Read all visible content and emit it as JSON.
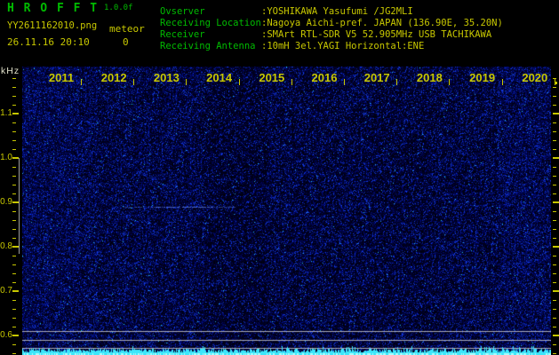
{
  "header": {
    "app_title": "H R O F F T",
    "version": "1.0.0f",
    "filename": "YY2611162010.png",
    "mode_label": "meteor",
    "datetime": "26.11.16 20:10",
    "meteor_count": "0",
    "info_rows": [
      {
        "label": "Ovserver",
        "value": ":YOSHIKAWA Yasufumi /JG2MLI"
      },
      {
        "label": "Receiving Location",
        "value": ":Nagoya Aichi-pref. JAPAN (136.90E, 35.20N)"
      },
      {
        "label": "Receiver",
        "value": ":SMArt RTL-SDR V5 52.905MHz USB TACHIKAWA"
      },
      {
        "label": "Receiving Antenna",
        "value": ":10mH 3el.YAGI Horizontal:ENE"
      }
    ]
  },
  "chart_data": {
    "type": "heatmap",
    "subtype": "radio-spectrogram-waterfall",
    "title": "HROFFT 10-minute meteor radio spectrogram",
    "x_axis": {
      "labels": [
        "2011",
        "2012",
        "2013",
        "2014",
        "2015",
        "2016",
        "2017",
        "2018",
        "2019",
        "2020"
      ],
      "meaning": "clock time HHMM, one-minute divisions from 20:11 to 20:20"
    },
    "y_axis": {
      "unit": "kHz",
      "major_tick_labels": [
        "1.1",
        "1.0",
        "0.9",
        "0.8",
        "0.7",
        "0.6"
      ],
      "minor_tick_step_khz": 0.02,
      "visible_range_khz": [
        0.56,
        1.21
      ]
    },
    "content": {
      "meteor_echo_count": 0,
      "background": "uniform blue receiver noise speckle, no strong meteor echoes",
      "faint_trace": {
        "frequency_khz": 0.89,
        "time_span": "approx 20:12 - 20:14"
      },
      "frequency_marker_bar_khz": {
        "from": 1.0,
        "to": 0.78
      },
      "horizontal_reference_lines_khz": [
        0.61,
        0.59,
        0.57
      ],
      "noise_floor_band": "bright cyan signal-level band along bottom edge"
    },
    "legend": "none",
    "grid": "off"
  },
  "colors": {
    "background": "#000000",
    "green": "#00bb00",
    "yellow": "#c8c800",
    "axis_unit": "#e2e2cc",
    "noise_blue": "#0000aa",
    "noise_bright": "#4466ff",
    "cyan_band": "#3ce6ff",
    "reference_line": "#c8c8cd",
    "marker_bar": "#c3c3c3"
  }
}
